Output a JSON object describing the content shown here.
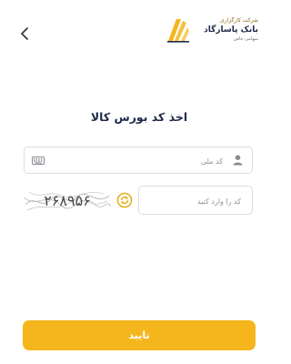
{
  "header": {
    "back_icon": "chevron-left-icon",
    "logo": {
      "line1": "شرکت کارگزاری",
      "line2": "بانک پاسارگاد",
      "line3": "سهامی خاص",
      "mark_color": "#F5B51C"
    }
  },
  "page": {
    "title": "اخذ کد بورس کالا"
  },
  "form": {
    "national_code": {
      "placeholder": "کد ملی",
      "value": "",
      "icon": "person-icon",
      "trailing_icon": "keyboard-icon"
    },
    "captcha": {
      "image_text": "۲۶۸۹۵۶",
      "refresh_icon": "refresh-icon",
      "input_placeholder": "کد را وارد کنید",
      "value": ""
    },
    "confirm_label": "تایید"
  },
  "colors": {
    "accent": "#F5B51C",
    "title": "#1F2A4A",
    "border": "#DADCE3",
    "placeholder": "#8F8F98"
  }
}
